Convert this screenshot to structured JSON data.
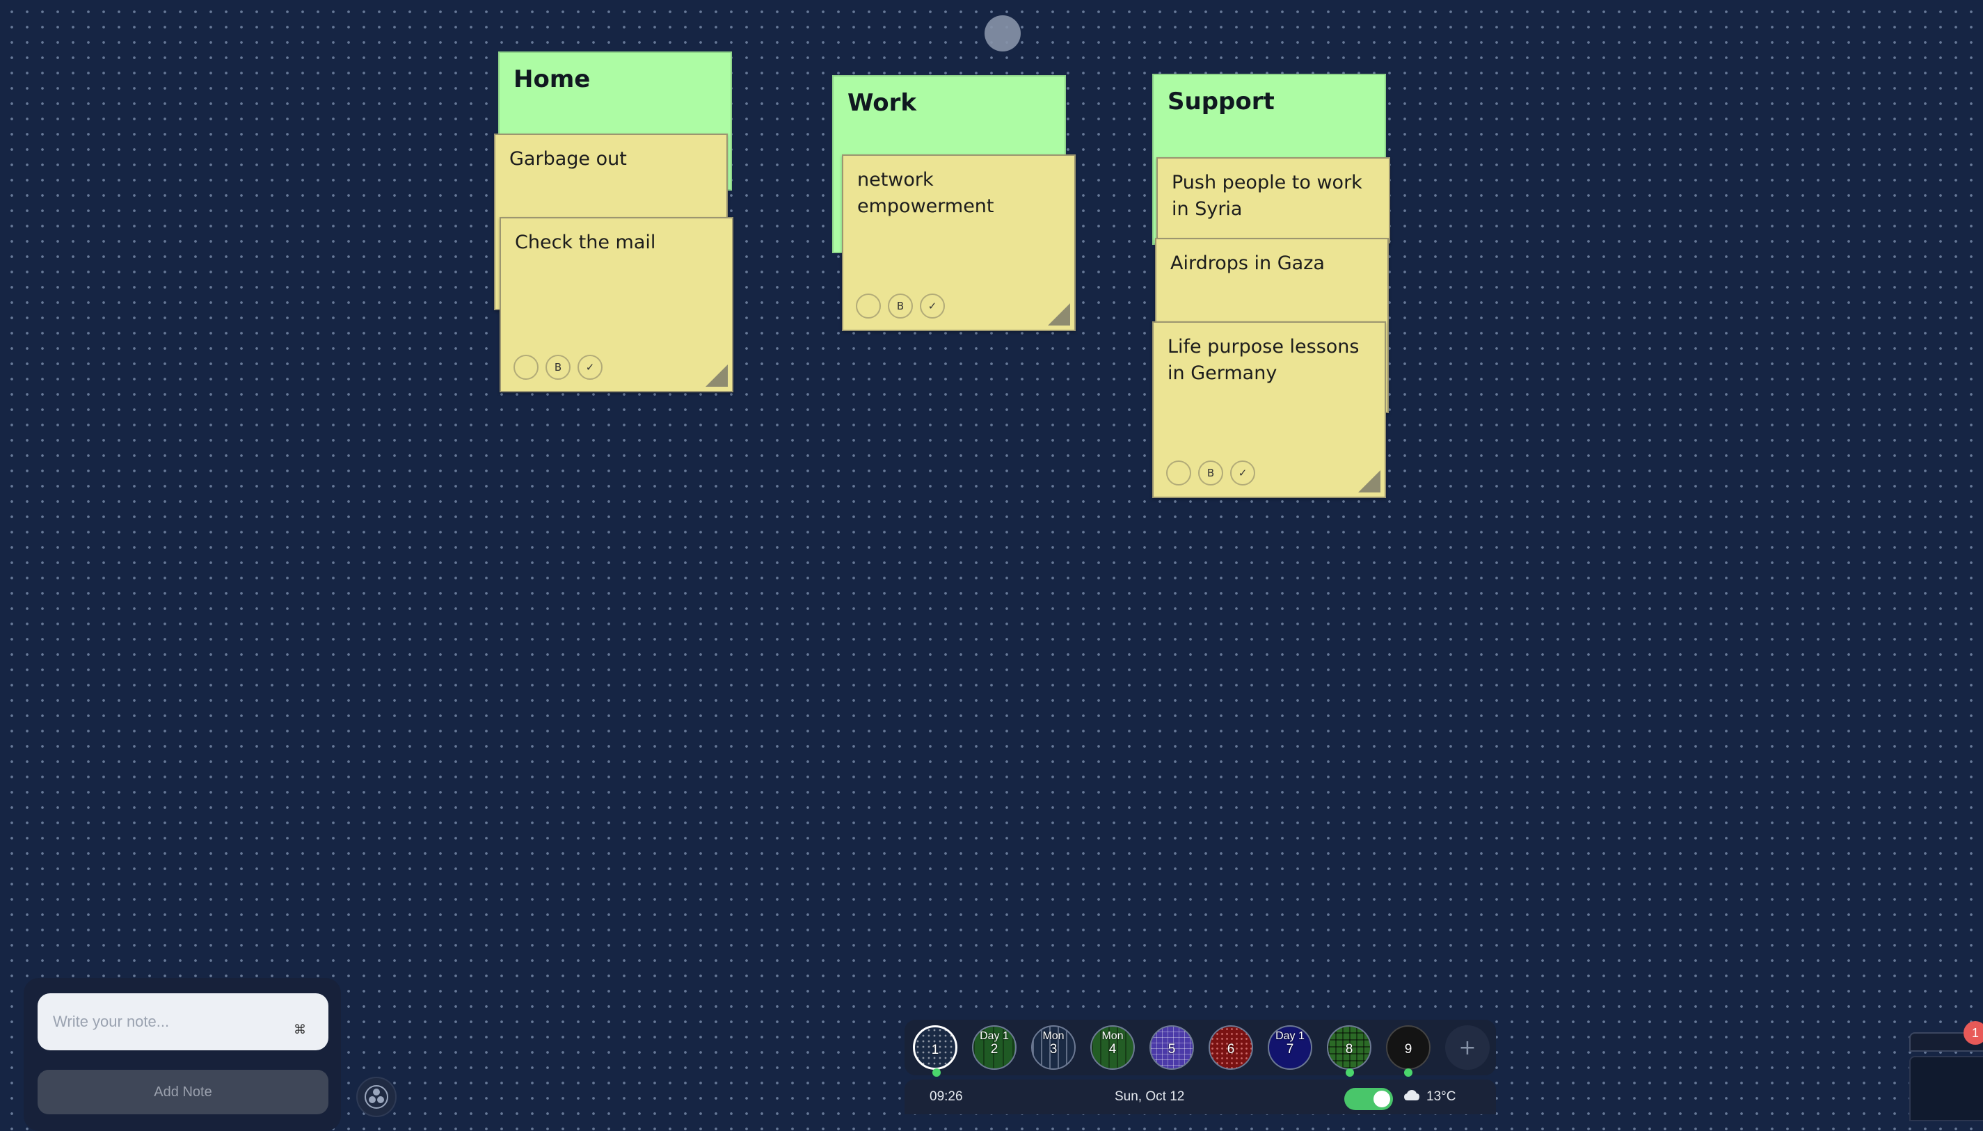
{
  "board": {
    "groups": [
      {
        "title": "Home",
        "notes": [
          "Garbage out",
          "Check the mail"
        ]
      },
      {
        "title": "Work",
        "notes": [
          "network empowerment"
        ]
      },
      {
        "title": "Support",
        "notes": [
          "Push people to work in Syria",
          "Airdrops in Gaza",
          "Life purpose lessons in Germany"
        ]
      }
    ],
    "note_controls": {
      "bold_label": "B",
      "check_label": "✓"
    }
  },
  "composer": {
    "placeholder": "Write your note...",
    "shortcut_icon": "⌘",
    "add_label": "Add Note"
  },
  "workspaces": [
    {
      "label": "",
      "number": "1",
      "active": true
    },
    {
      "label": "Day 1",
      "number": "2"
    },
    {
      "label": "Mon",
      "number": "3"
    },
    {
      "label": "Mon",
      "number": "4"
    },
    {
      "label": "",
      "number": "5"
    },
    {
      "label": "",
      "number": "6"
    },
    {
      "label": "Day 1",
      "number": "7"
    },
    {
      "label": "",
      "number": "8"
    },
    {
      "label": "",
      "number": "9"
    }
  ],
  "add_workspace_label": "+",
  "status": {
    "time": "09:26",
    "date": "Sun, Oct 12",
    "temperature": "13°C",
    "toggle_on": true
  },
  "notifications": {
    "count": "1"
  },
  "colors": {
    "group_header": "#adfca4",
    "note": "#ece494",
    "background": "#162544",
    "toggle": "#49c66a",
    "badge": "#e85a58"
  }
}
